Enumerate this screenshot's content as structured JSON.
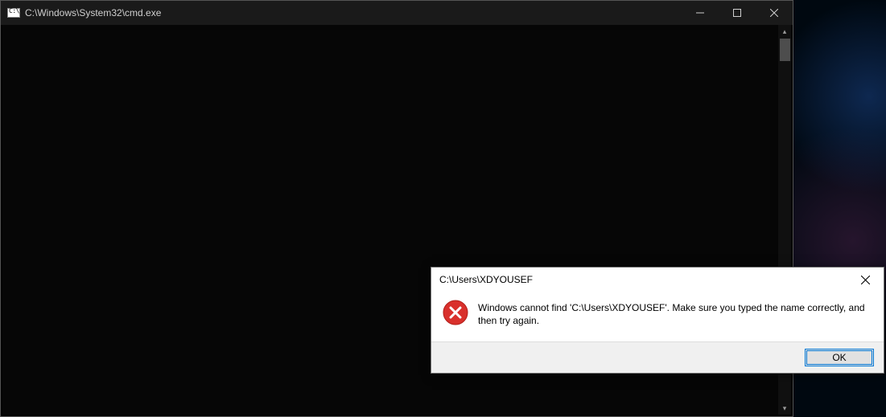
{
  "cmd": {
    "title": "C:\\Windows\\System32\\cmd.exe"
  },
  "dialog": {
    "title": "C:\\Users\\XDYOUSEF",
    "message": "Windows cannot find 'C:\\Users\\XDYOUSEF'. Make sure you typed the name correctly, and then try again.",
    "ok_label": "OK"
  }
}
